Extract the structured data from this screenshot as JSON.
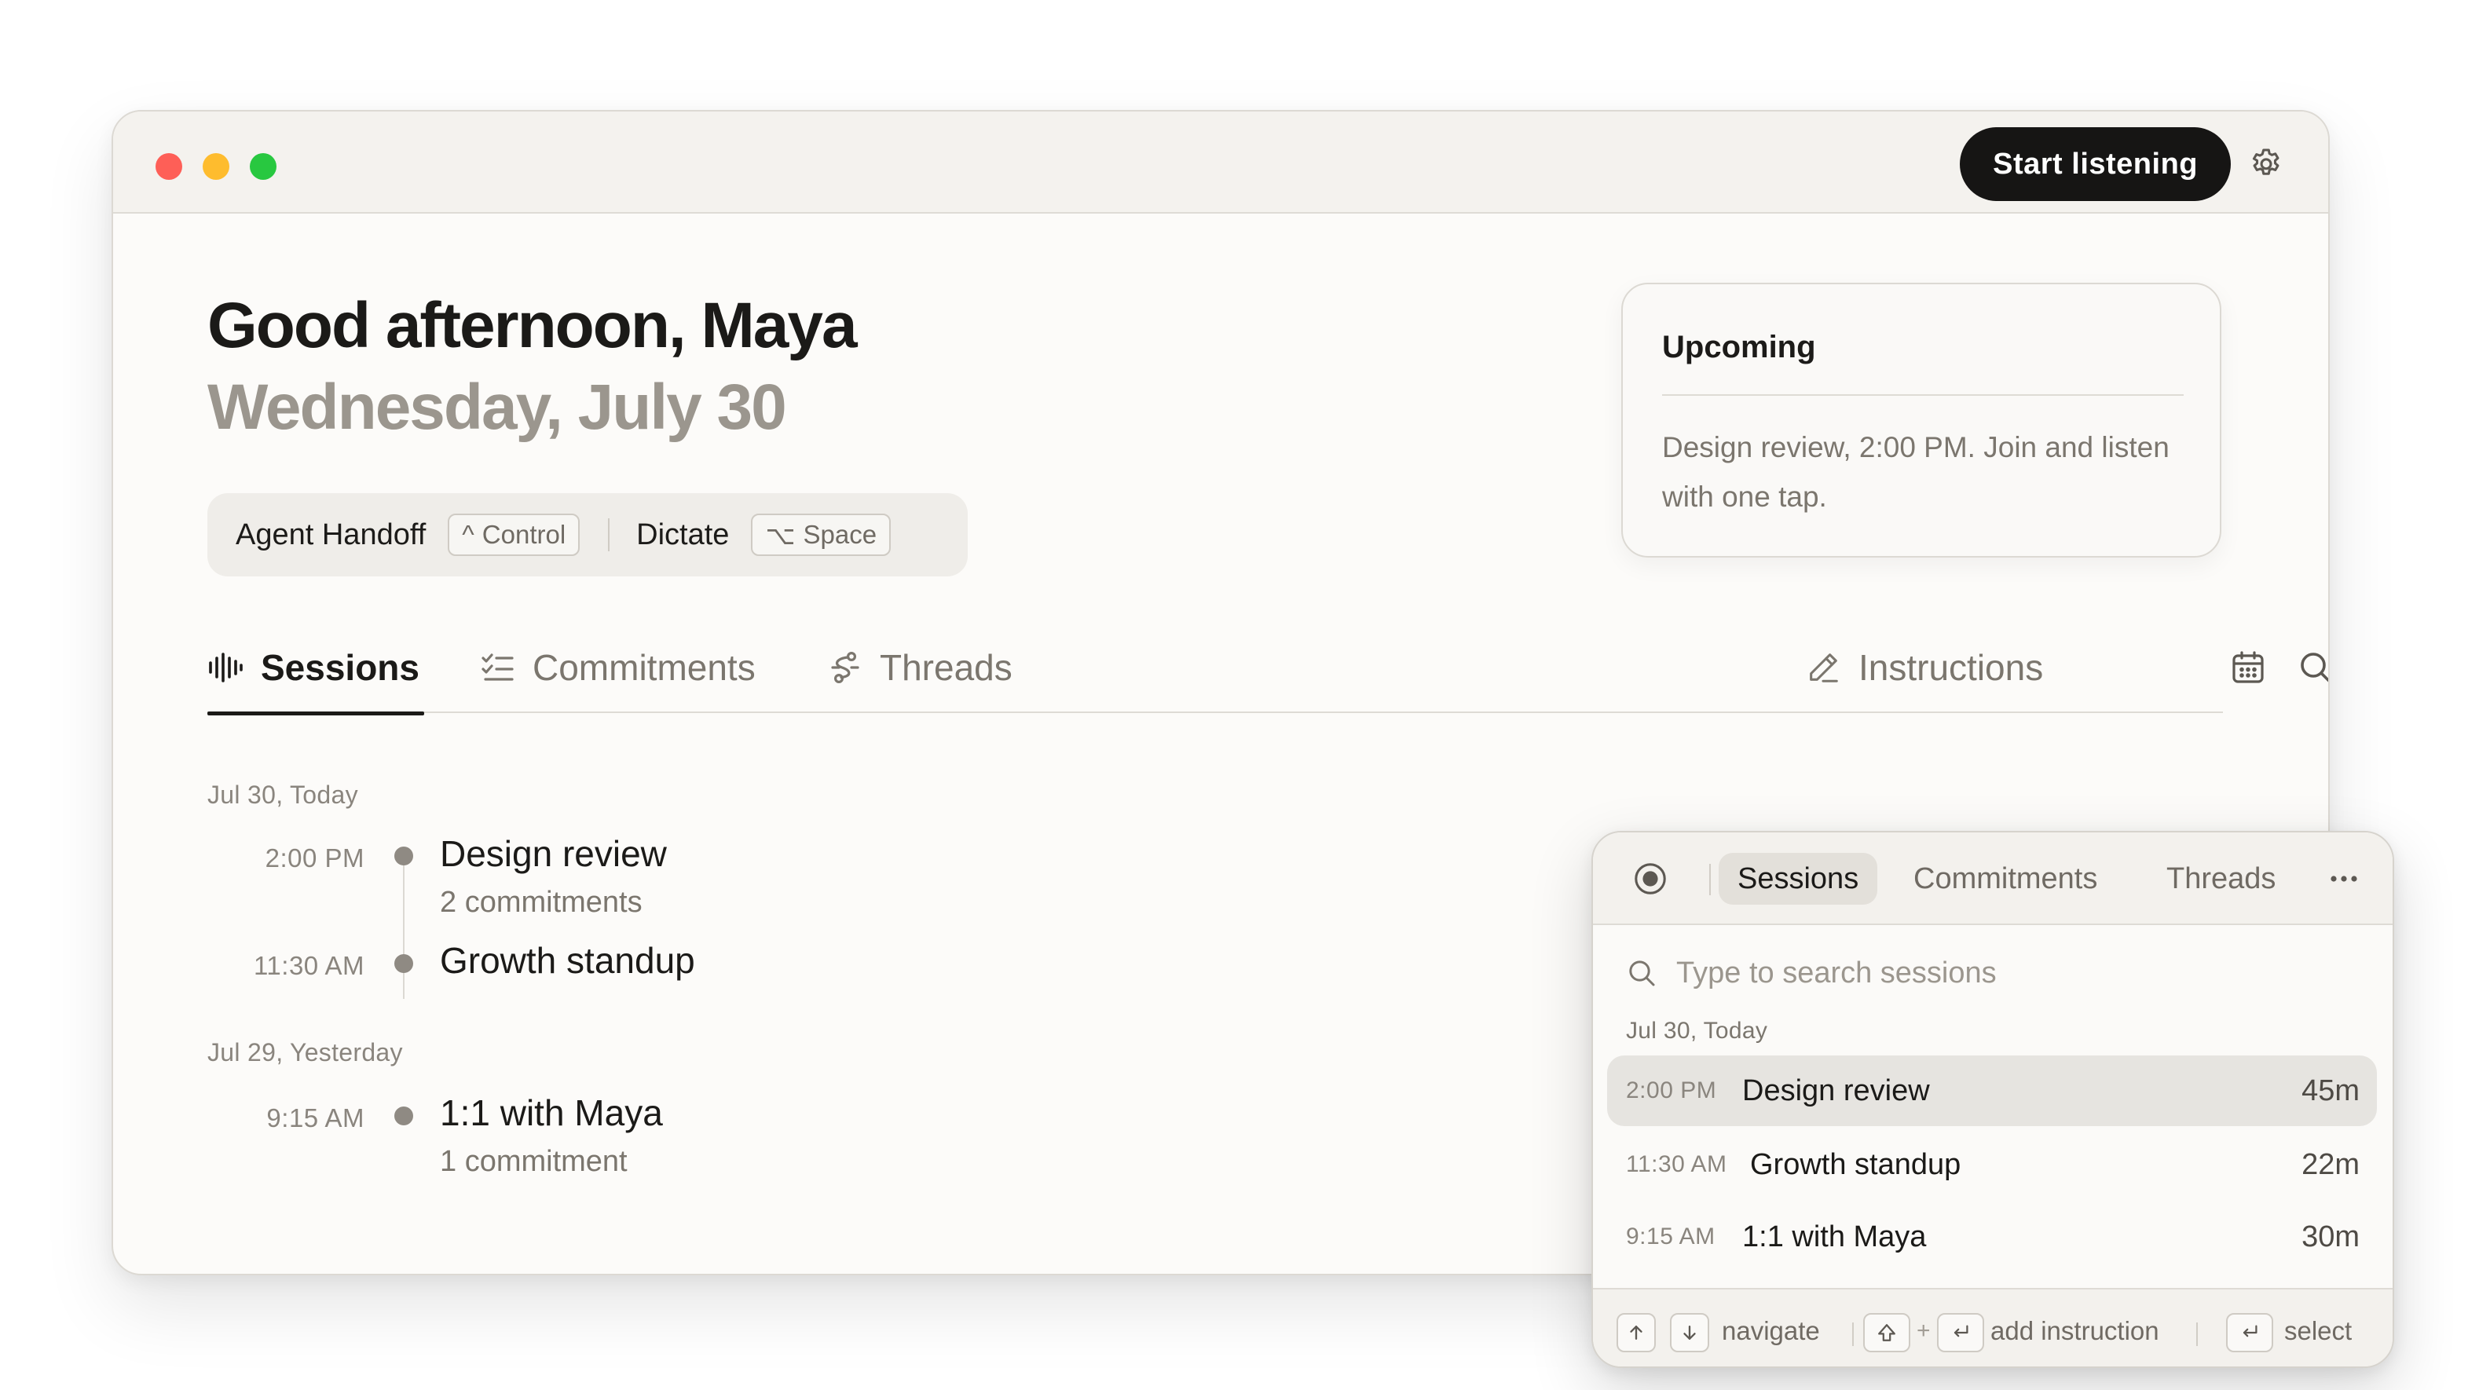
{
  "titlebar": {
    "start_button": "Start listening",
    "settings_icon": "gear-icon"
  },
  "header": {
    "greeting": "Good afternoon, Maya",
    "date": "Wednesday, July 30"
  },
  "shortcuts": [
    {
      "label": "Agent Handoff",
      "key_symbol": "^",
      "key_label": "Control"
    },
    {
      "label": "Dictate",
      "key_symbol": "⌥",
      "key_label": "Space"
    }
  ],
  "upcoming": {
    "title": "Upcoming",
    "body": "Design review, 2:00 PM. Join and listen with one tap."
  },
  "tabs": {
    "sessions": "Sessions",
    "commitments": "Commitments",
    "threads": "Threads",
    "instructions": "Instructions",
    "active": "Sessions"
  },
  "days": [
    {
      "label": "Jul 30, Today",
      "sessions": [
        {
          "time": "2:00 PM",
          "title": "Design review",
          "sub": "2 commitments"
        },
        {
          "time": "11:30 AM",
          "title": "Growth standup",
          "sub": ""
        }
      ]
    },
    {
      "label": "Jul 29, Yesterday",
      "sessions": [
        {
          "time": "9:15 AM",
          "title": "1:1 with Maya",
          "sub": "1 commitment"
        }
      ]
    }
  ],
  "popup": {
    "tabs": {
      "sessions": "Sessions",
      "commitments": "Commitments",
      "threads": "Threads"
    },
    "search_placeholder": "Type to search sessions",
    "day_label": "Jul 30, Today",
    "rows": [
      {
        "time": "2:00 PM",
        "title": "Design review",
        "duration": "45m",
        "selected": true
      },
      {
        "time": "11:30 AM",
        "title": "Growth standup",
        "duration": "22m",
        "selected": false
      },
      {
        "time": "9:15 AM",
        "title": "1:1 with Maya",
        "duration": "30m",
        "selected": false
      }
    ],
    "footer": {
      "navigate": "navigate",
      "add_instruction": "add instruction",
      "plus": "+",
      "select": "select"
    }
  },
  "colors": {
    "accent_dark": "#161514",
    "background": "#fcfbf9",
    "muted_text": "#9b968e",
    "traffic_red": "#fe5f57",
    "traffic_yellow": "#febc2e",
    "traffic_green": "#28c840"
  }
}
